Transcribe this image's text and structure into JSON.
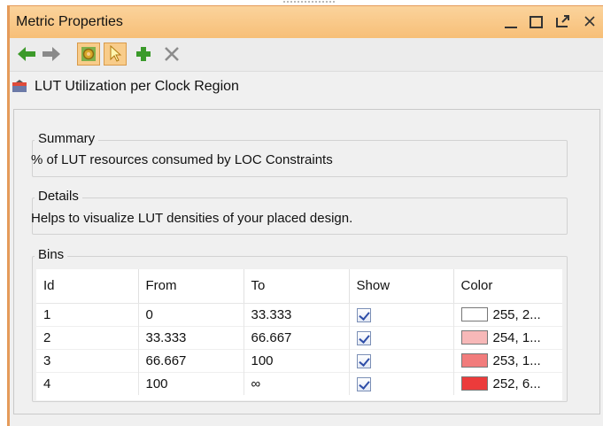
{
  "window": {
    "title": "Metric Properties",
    "controls": [
      "minimize-icon",
      "maximize-icon",
      "float-icon",
      "close-icon"
    ]
  },
  "toolbar": {
    "buttons": [
      {
        "name": "back-button",
        "icon": "arrow-left-icon",
        "color": "#3c9a2a"
      },
      {
        "name": "forward-button",
        "icon": "arrow-right-icon",
        "color": "#8a8a8a"
      },
      {
        "name": "metric-settings-button",
        "icon": "gear-icon",
        "active": true
      },
      {
        "name": "select-button",
        "icon": "pointer-icon",
        "active": true
      },
      {
        "name": "add-button",
        "icon": "plus-icon",
        "color": "#3a9a2a"
      },
      {
        "name": "remove-button",
        "icon": "x-icon",
        "color": "#8c8c8c"
      }
    ]
  },
  "heading": {
    "icon": "metric-icon",
    "text": "LUT Utilization per Clock Region"
  },
  "summary": {
    "legend": "Summary",
    "text": "% of LUT resources consumed by LOC Constraints"
  },
  "details": {
    "legend": "Details",
    "text": "Helps to visualize LUT densities of your placed design."
  },
  "bins": {
    "legend": "Bins",
    "columns": [
      "Id",
      "From",
      "To",
      "Show",
      "Color"
    ],
    "rows": [
      {
        "id": "1",
        "from": "0",
        "to": "33.333",
        "show": true,
        "swatch": "#ffffff",
        "color": "255, 2..."
      },
      {
        "id": "2",
        "from": "33.333",
        "to": "66.667",
        "show": true,
        "swatch": "#f7b8b8",
        "color": "254, 1..."
      },
      {
        "id": "3",
        "from": "66.667",
        "to": "100",
        "show": true,
        "swatch": "#f17c7c",
        "color": "253, 1..."
      },
      {
        "id": "4",
        "from": "100",
        "to": "∞",
        "show": true,
        "swatch": "#ec3b3b",
        "color": "252, 6..."
      }
    ]
  },
  "colors": {
    "titlebar": "#f8c580",
    "accent_border": "#e59b5a"
  }
}
